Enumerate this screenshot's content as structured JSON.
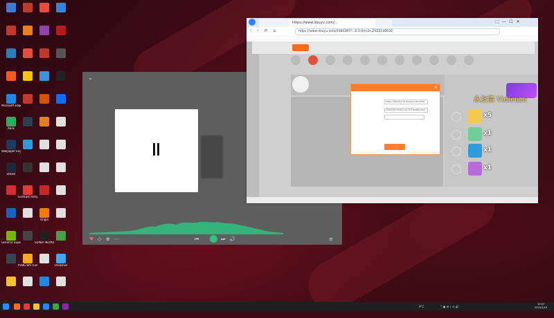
{
  "desktop": {
    "icons": [
      {
        "label": "",
        "color": "#3b7bd6"
      },
      {
        "label": "",
        "color": "#c0392b"
      },
      {
        "label": "",
        "color": "#e74c3c"
      },
      {
        "label": "",
        "color": "#2e86de"
      },
      {
        "label": "",
        "color": "#c0392b"
      },
      {
        "label": "",
        "color": "#e67e22"
      },
      {
        "label": "",
        "color": "#8e44ad"
      },
      {
        "label": "",
        "color": "#b71c1c"
      },
      {
        "label": "",
        "color": "#2980b9"
      },
      {
        "label": "",
        "color": "#e74c3c"
      },
      {
        "label": "",
        "color": "#c0392b"
      },
      {
        "label": "",
        "color": "#555555"
      },
      {
        "label": "",
        "color": "#ff5722"
      },
      {
        "label": "",
        "color": "#f1c40f"
      },
      {
        "label": "",
        "color": "#3498db"
      },
      {
        "label": "",
        "color": "#222222"
      },
      {
        "label": "Microsoft Edge",
        "color": "#1e88e5"
      },
      {
        "label": "",
        "color": "#c0392b"
      },
      {
        "label": "",
        "color": "#d35400"
      },
      {
        "label": "",
        "color": "#0d6efd"
      },
      {
        "label": "Xbox",
        "color": "#27ae60"
      },
      {
        "label": "",
        "color": "#2c3e50"
      },
      {
        "label": "",
        "color": "#e67e22"
      },
      {
        "label": "",
        "color": "#e0e0e0"
      },
      {
        "label": "Wallpaper Engine",
        "color": "#1e3a5f"
      },
      {
        "label": "",
        "color": "#3498db"
      },
      {
        "label": "",
        "color": "#e0e0e0"
      },
      {
        "label": "",
        "color": "#e0e0e0"
      },
      {
        "label": "Steam",
        "color": "#1b2838"
      },
      {
        "label": "",
        "color": "#333333"
      },
      {
        "label": "",
        "color": "#e0e0e0"
      },
      {
        "label": "",
        "color": "#e0e0e0"
      },
      {
        "label": "",
        "color": "#d32f2f"
      },
      {
        "label": "Forecast Party",
        "color": "#e53935"
      },
      {
        "label": "",
        "color": "#c62828"
      },
      {
        "label": "",
        "color": "#e0e0e0"
      },
      {
        "label": "",
        "color": "#1565c0"
      },
      {
        "label": "",
        "color": "#e0e0e0"
      },
      {
        "label": "Origin",
        "color": "#f57c00"
      },
      {
        "label": "",
        "color": "#e0e0e0"
      },
      {
        "label": "GeForce Experience",
        "color": "#76b900"
      },
      {
        "label": "",
        "color": "#444444"
      },
      {
        "label": "SUPER PEOPLE CBT",
        "color": "#212121"
      },
      {
        "label": "",
        "color": "#43a047"
      },
      {
        "label": "",
        "color": "#37474f"
      },
      {
        "label": "PUBG BATTLEGRO...",
        "color": "#f9a825"
      },
      {
        "label": "",
        "color": "#e0e0e0"
      },
      {
        "label": "OneDrive",
        "color": "#42a5f5"
      },
      {
        "label": "",
        "color": "#fbc02d"
      },
      {
        "label": "",
        "color": "#e0e0e0"
      },
      {
        "label": "",
        "color": "#1e88e5"
      },
      {
        "label": "",
        "color": "#e0e0e0"
      }
    ]
  },
  "player": {
    "collapse_icon": "⌄",
    "time_text": "",
    "controls": [
      "♥",
      "◇",
      "⊕",
      "⋯",
      "⏮",
      "⏸",
      "⏭",
      "🔊",
      "≡"
    ]
  },
  "browser": {
    "tabs": [
      {
        "label": "",
        "active": false
      },
      {
        "label": "https://www.douyu.com/...",
        "active": true
      },
      {
        "label": "",
        "active": false
      }
    ],
    "url": "https://www.douyu.com/3484397?...6:3:0ms3s,Z0ZZ146030",
    "window_buttons": [
      "⬚",
      "—",
      "☐",
      "✕"
    ],
    "bookmarks": [
      "",
      "",
      "",
      ""
    ],
    "room_title": "",
    "status_left": "",
    "status_right": ""
  },
  "dialog": {
    "title": "",
    "close": "×",
    "field1_value": "rtmp://sendtc3a.douyu.com/live",
    "field2_value": "3484397rf0B1CAL7E7boddc/dxs",
    "copy_label": "",
    "notes": [
      "",
      "",
      "",
      ""
    ],
    "button": ""
  },
  "overlay": {
    "title": "永友情 Vidienza",
    "rows": [
      {
        "count": "x5",
        "who": "",
        "color": "#f2c94c"
      },
      {
        "count": "x1",
        "who": "",
        "color": "#6fcf97"
      },
      {
        "count": "x1",
        "who": "",
        "color": "#2d9cdb"
      },
      {
        "count": "x1",
        "who": "",
        "color": "#bb6bd9"
      }
    ]
  },
  "taskbar": {
    "tray_text": "9°C",
    "time": "12:07",
    "date": "2022/1/19"
  }
}
